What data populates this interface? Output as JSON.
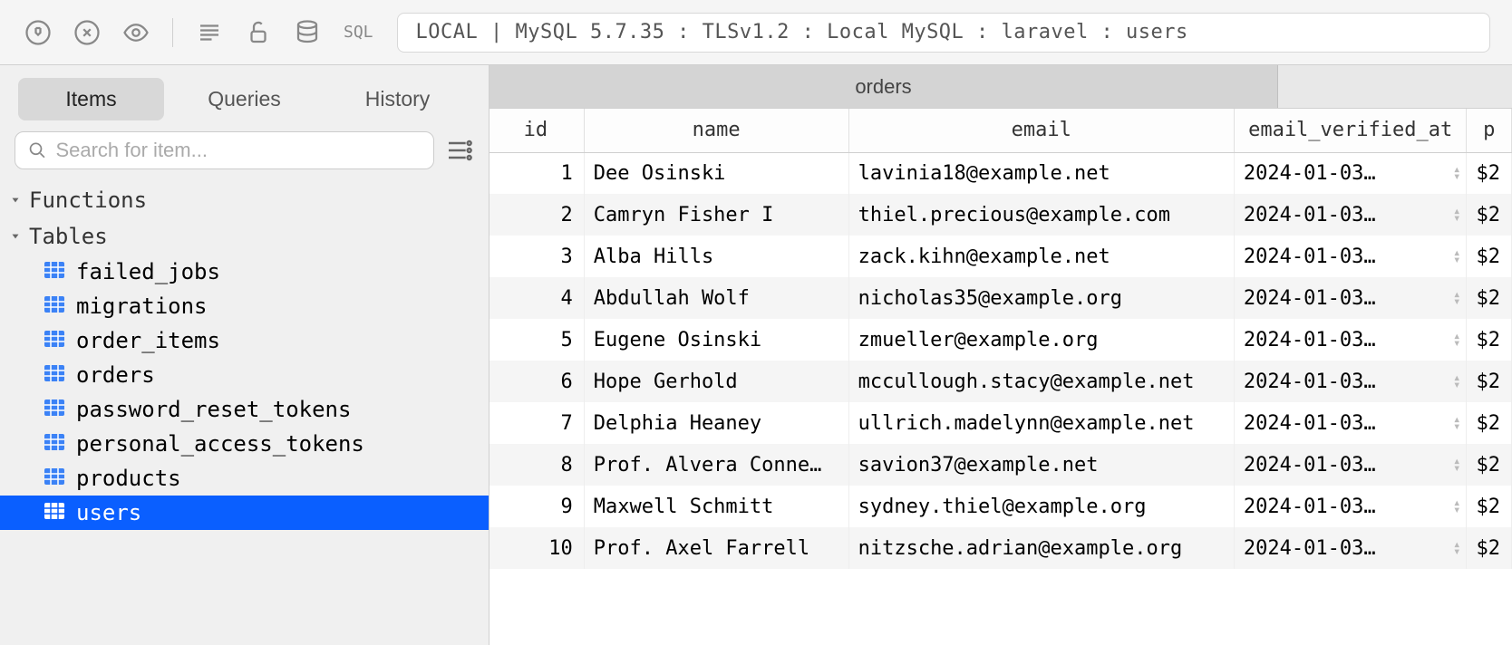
{
  "toolbar": {
    "sql_label": "SQL",
    "connection": "LOCAL | MySQL 5.7.35 : TLSv1.2 : Local MySQL : laravel : users"
  },
  "sidebar": {
    "tabs": [
      {
        "label": "Items",
        "active": true
      },
      {
        "label": "Queries",
        "active": false
      },
      {
        "label": "History",
        "active": false
      }
    ],
    "search_placeholder": "Search for item...",
    "groups": [
      {
        "label": "Functions",
        "expanded": true,
        "items": []
      },
      {
        "label": "Tables",
        "expanded": true,
        "items": [
          {
            "name": "failed_jobs",
            "selected": false
          },
          {
            "name": "migrations",
            "selected": false
          },
          {
            "name": "order_items",
            "selected": false
          },
          {
            "name": "orders",
            "selected": false
          },
          {
            "name": "password_reset_tokens",
            "selected": false
          },
          {
            "name": "personal_access_tokens",
            "selected": false
          },
          {
            "name": "products",
            "selected": false
          },
          {
            "name": "users",
            "selected": true
          }
        ]
      }
    ]
  },
  "content": {
    "tab_label": "orders",
    "columns": [
      "id",
      "name",
      "email",
      "email_verified_at",
      "p"
    ],
    "rows": [
      {
        "id": "1",
        "name": "Dee Osinski",
        "email": "lavinia18@example.net",
        "date": "2024-01-03…",
        "p": "$2"
      },
      {
        "id": "2",
        "name": "Camryn Fisher I",
        "email": "thiel.precious@example.com",
        "date": "2024-01-03…",
        "p": "$2"
      },
      {
        "id": "3",
        "name": "Alba Hills",
        "email": "zack.kihn@example.net",
        "date": "2024-01-03…",
        "p": "$2"
      },
      {
        "id": "4",
        "name": "Abdullah Wolf",
        "email": "nicholas35@example.org",
        "date": "2024-01-03…",
        "p": "$2"
      },
      {
        "id": "5",
        "name": "Eugene Osinski",
        "email": "zmueller@example.org",
        "date": "2024-01-03…",
        "p": "$2"
      },
      {
        "id": "6",
        "name": "Hope Gerhold",
        "email": "mccullough.stacy@example.net",
        "date": "2024-01-03…",
        "p": "$2"
      },
      {
        "id": "7",
        "name": "Delphia Heaney",
        "email": "ullrich.madelynn@example.net",
        "date": "2024-01-03…",
        "p": "$2"
      },
      {
        "id": "8",
        "name": "Prof. Alvera Conne…",
        "email": "savion37@example.net",
        "date": "2024-01-03…",
        "p": "$2"
      },
      {
        "id": "9",
        "name": "Maxwell Schmitt",
        "email": "sydney.thiel@example.org",
        "date": "2024-01-03…",
        "p": "$2"
      },
      {
        "id": "10",
        "name": "Prof. Axel Farrell",
        "email": "nitzsche.adrian@example.org",
        "date": "2024-01-03…",
        "p": "$2"
      }
    ]
  }
}
